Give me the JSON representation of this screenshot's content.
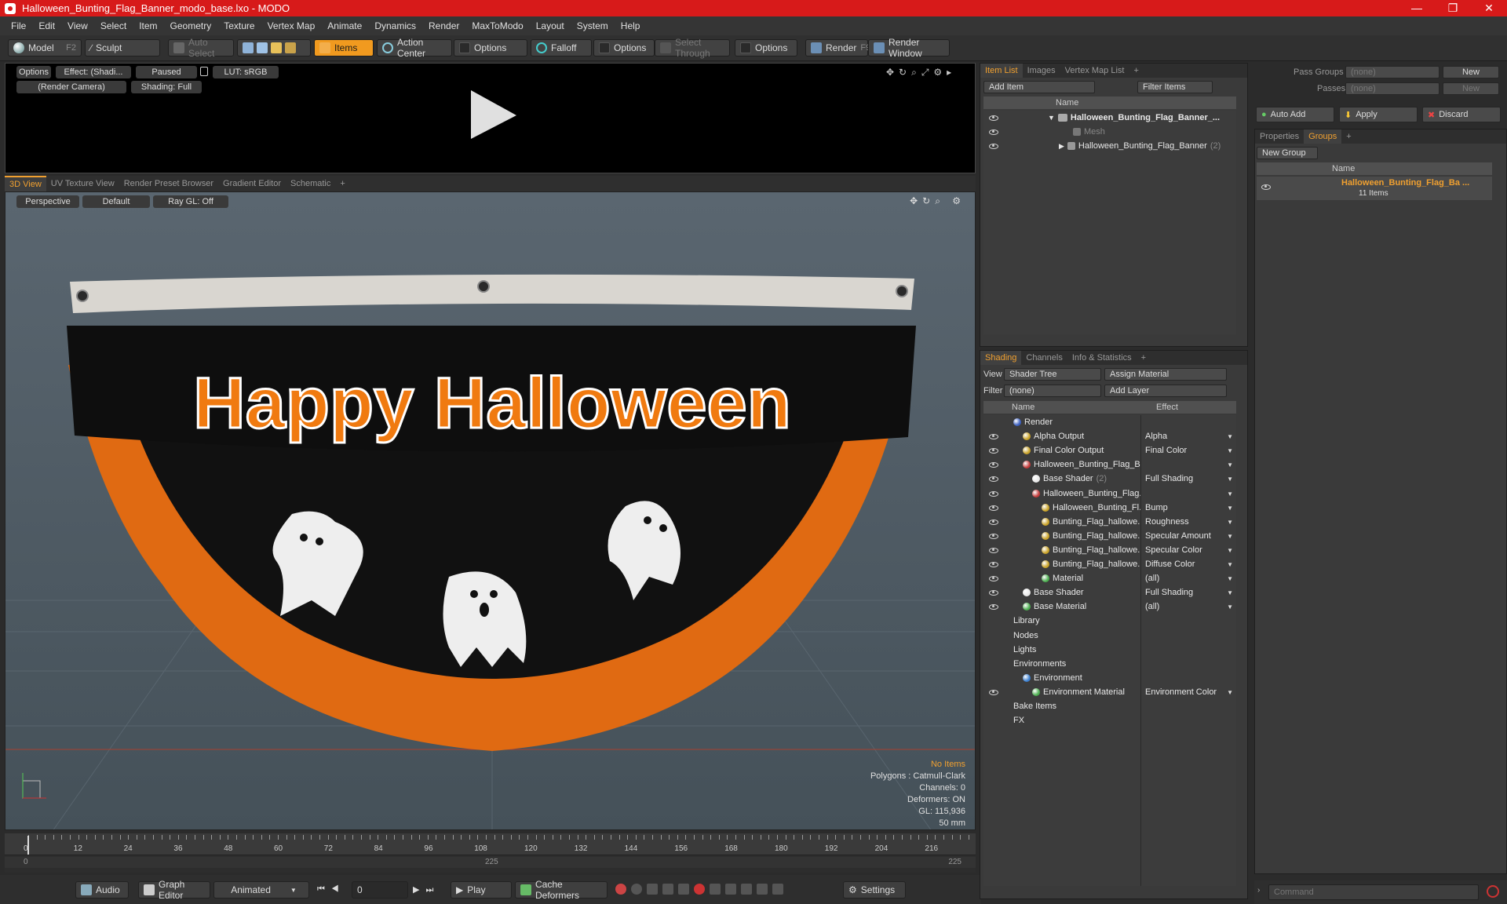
{
  "window": {
    "title": "Halloween_Bunting_Flag_Banner_modo_base.lxo - MODO",
    "controls": [
      "—",
      "❐",
      "✕"
    ]
  },
  "menu": [
    "File",
    "Edit",
    "View",
    "Select",
    "Item",
    "Geometry",
    "Texture",
    "Vertex Map",
    "Animate",
    "Dynamics",
    "Render",
    "MaxToModo",
    "Layout",
    "System",
    "Help"
  ],
  "toolbar": {
    "model": "Model",
    "model_key": "F2",
    "sculpt": "Sculpt",
    "auto_select": "Auto Select",
    "items": "Items",
    "action_center": "Action Center",
    "options1": "Options",
    "falloff": "Falloff",
    "options2": "Options",
    "select_through": "Select Through",
    "options3": "Options",
    "render": "Render",
    "render_key": "F9",
    "render_window": "Render Window"
  },
  "render_preview": {
    "options": "Options",
    "effect": "Effect: (Shadi...",
    "paused": "Paused",
    "lut": "LUT: sRGB",
    "camera": "(Render Camera)",
    "shading": "Shading: Full"
  },
  "viewport_tabs": [
    "3D View",
    "UV Texture View",
    "Render Preset Browser",
    "Gradient Editor",
    "Schematic",
    "+"
  ],
  "viewport": {
    "perspective": "Perspective",
    "default": "Default",
    "raygl": "Ray GL: Off",
    "banner_text": "Happy Halloween",
    "info": {
      "selection": "No Items",
      "polygons": "Polygons : Catmull-Clark",
      "channels": "Channels: 0",
      "deformers": "Deformers: ON",
      "gl": "GL: 115,936",
      "unit": "50 mm"
    }
  },
  "timeline": {
    "ticks": [
      "0",
      "12",
      "24",
      "36",
      "48",
      "60",
      "72",
      "84",
      "96",
      "108",
      "120",
      "132",
      "144",
      "156",
      "168",
      "180",
      "192",
      "204",
      "216"
    ],
    "start": "0",
    "mid": "225",
    "end": "225"
  },
  "bottombar": {
    "audio": "Audio",
    "graph_editor": "Graph Editor",
    "animated": "Animated",
    "frame": "0",
    "play": "Play",
    "cache_deformers": "Cache Deformers",
    "settings": "Settings"
  },
  "item_list": {
    "tabs": [
      "Item List",
      "Images",
      "Vertex Map List",
      "+"
    ],
    "add_item": "Add Item",
    "filter_items": "Filter Items",
    "col_name": "Name",
    "rows": [
      {
        "label": "Halloween_Bunting_Flag_Banner_...",
        "bold": true
      },
      {
        "label": "Mesh",
        "dim": true
      },
      {
        "label": "Halloween_Bunting_Flag_Banner",
        "count": "(2)"
      }
    ]
  },
  "shading": {
    "tabs": [
      "Shading",
      "Channels",
      "Info & Statistics",
      "+"
    ],
    "view_label": "View",
    "view_value": "Shader Tree",
    "assign_material": "Assign Material",
    "filter_label": "Filter",
    "filter_value": "(none)",
    "add_layer": "Add Layer",
    "col_name": "Name",
    "col_effect": "Effect",
    "rows": [
      {
        "name": "Render",
        "effect": ""
      },
      {
        "name": "Alpha Output",
        "effect": "Alpha"
      },
      {
        "name": "Final Color Output",
        "effect": "Final Color"
      },
      {
        "name": "Halloween_Bunting_Flag_B...",
        "effect": ""
      },
      {
        "name": "Base Shader",
        "count": "(2)",
        "effect": "Full Shading"
      },
      {
        "name": "Halloween_Bunting_Flag...",
        "effect": ""
      },
      {
        "name": "Halloween_Bunting_Fl...",
        "effect": "Bump"
      },
      {
        "name": "Bunting_Flag_hallowe...",
        "effect": "Roughness"
      },
      {
        "name": "Bunting_Flag_hallowe...",
        "effect": "Specular Amount"
      },
      {
        "name": "Bunting_Flag_hallowe...",
        "effect": "Specular Color"
      },
      {
        "name": "Bunting_Flag_hallowe...",
        "effect": "Diffuse Color"
      },
      {
        "name": "Material",
        "effect": "(all)"
      },
      {
        "name": "Base Shader",
        "effect": "Full Shading"
      },
      {
        "name": "Base Material",
        "effect": "(all)"
      },
      {
        "name": "Library",
        "effect": ""
      },
      {
        "name": "Nodes",
        "effect": ""
      },
      {
        "name": "Lights",
        "effect": ""
      },
      {
        "name": "Environments",
        "effect": ""
      },
      {
        "name": "Environment",
        "effect": ""
      },
      {
        "name": "Environment Material",
        "effect": "Environment Color"
      },
      {
        "name": "Bake Items",
        "effect": ""
      },
      {
        "name": "FX",
        "effect": ""
      }
    ]
  },
  "passes": {
    "pass_groups": "Pass Groups",
    "passes": "Passes",
    "none": "(none)",
    "new": "New"
  },
  "actions": {
    "auto_add": "Auto Add",
    "apply": "Apply",
    "discard": "Discard"
  },
  "groups": {
    "tabs": [
      "Properties",
      "Groups",
      "+"
    ],
    "new_group": "New Group",
    "col_name": "Name",
    "group_name": "Halloween_Bunting_Flag_Ba ...",
    "group_count": "11 Items"
  },
  "command": {
    "placeholder": "Command"
  }
}
